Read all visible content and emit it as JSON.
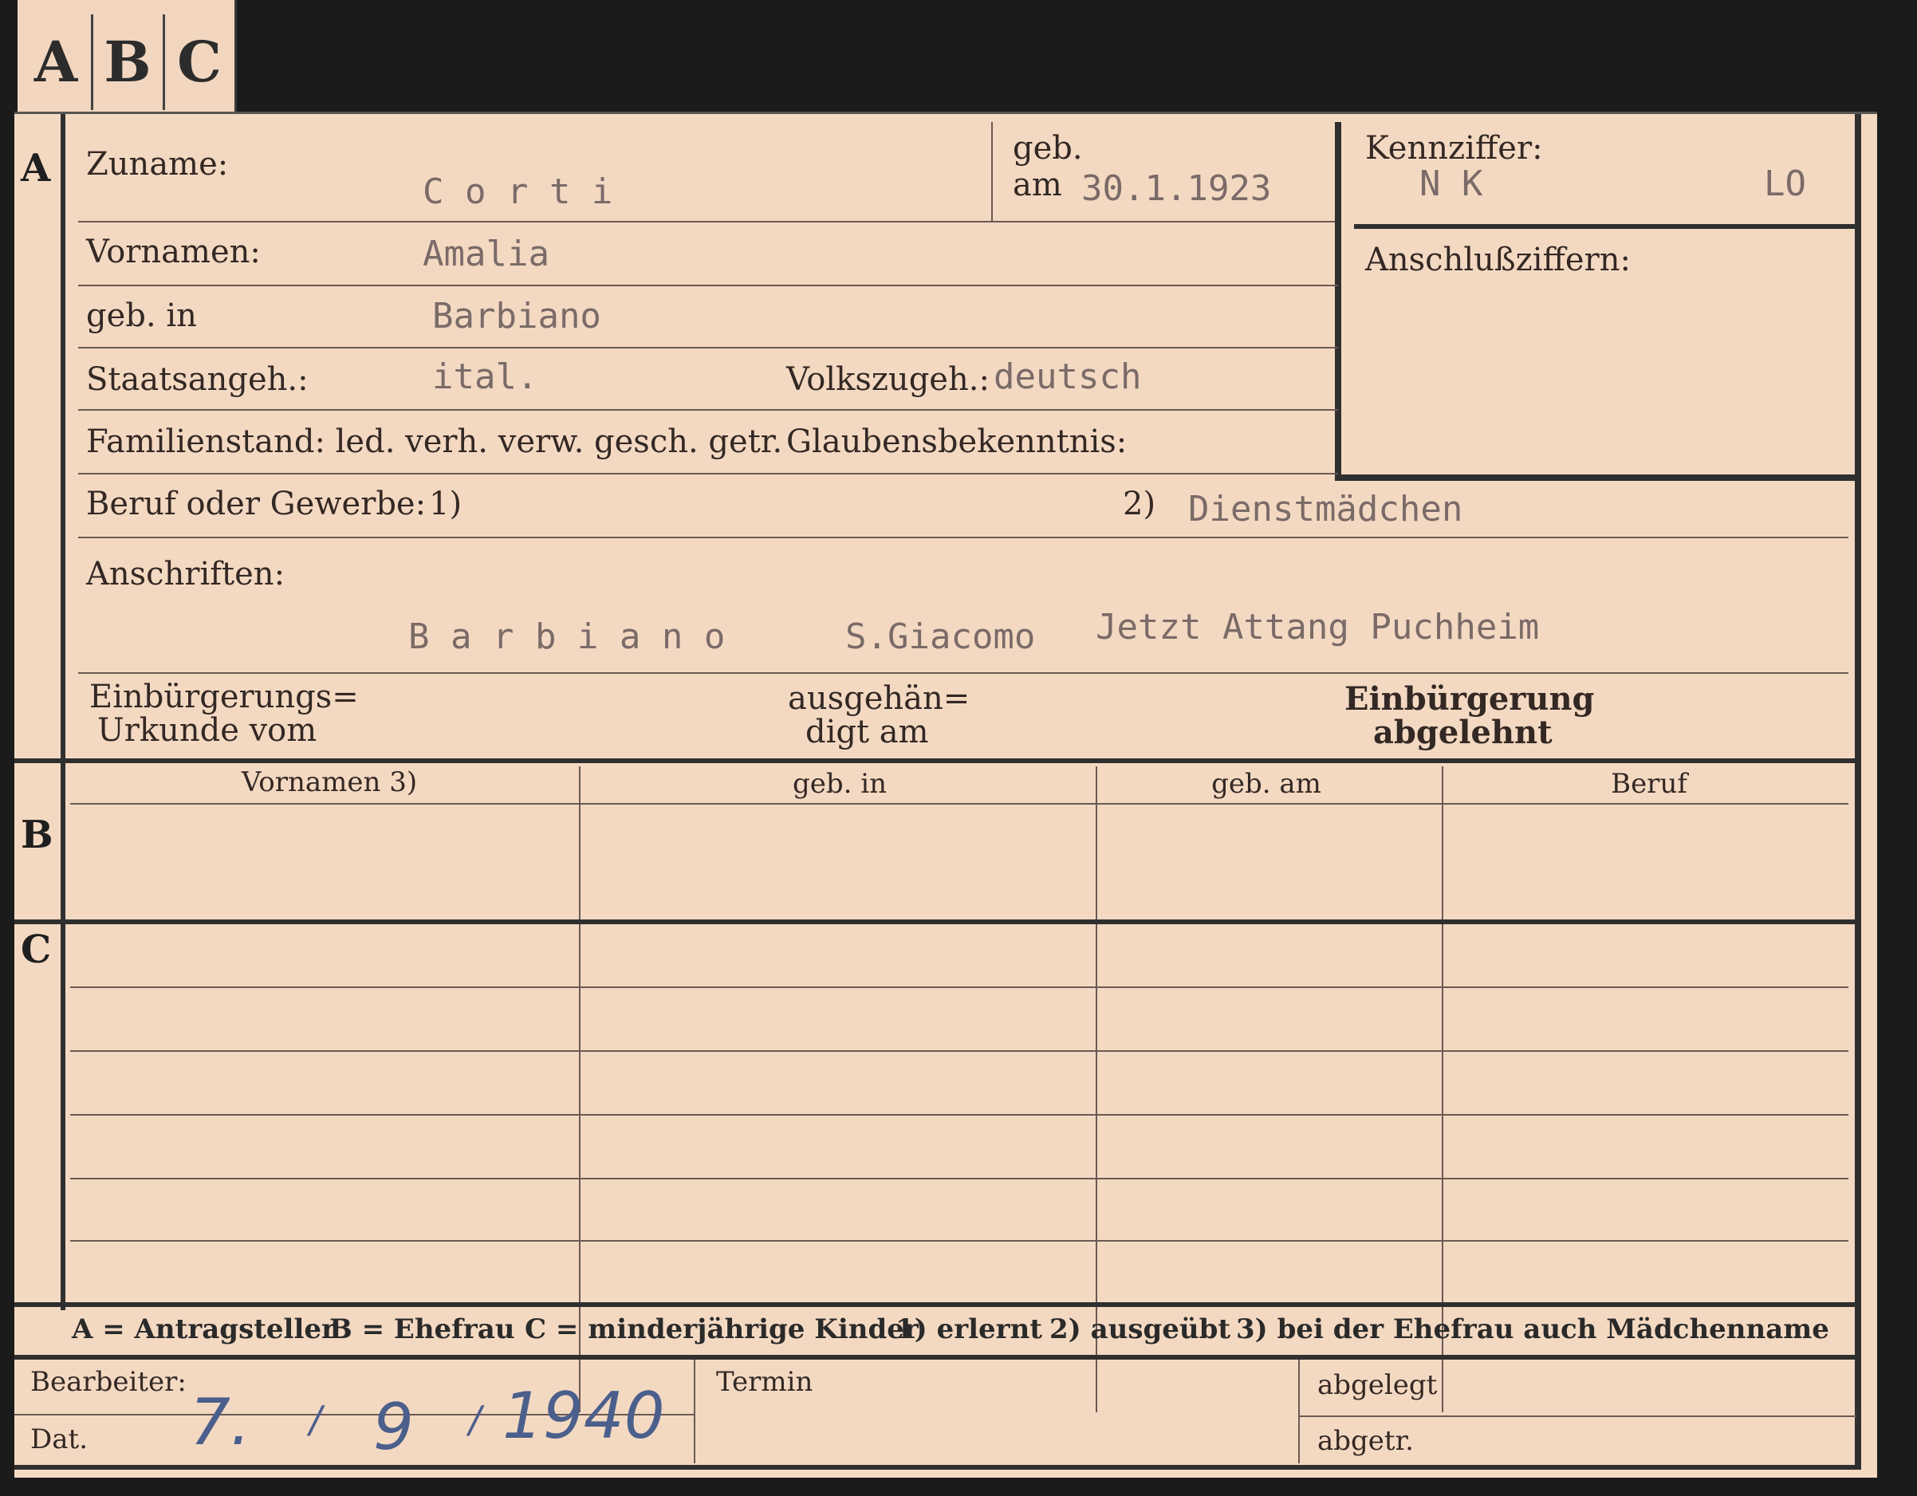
{
  "tabs": [
    "A",
    "B",
    "C"
  ],
  "sections": {
    "a": "A",
    "b": "B",
    "c": "C"
  },
  "labels": {
    "zuname": "Zuname:",
    "geb_line1": "geb.",
    "geb_line2": "am",
    "kennziffer": "Kennziffer:",
    "vornamen": "Vornamen:",
    "anschlussziffern": "Anschlußziffern:",
    "geb_in": "geb. in",
    "staatsangeh": "Staatsangeh.:",
    "volkszugeh": "Volkszugeh.:",
    "familienstand": "Familienstand: led. verh. verw. gesch. getr.",
    "glaubensbekenntnis": "Glaubensbekenntnis:",
    "beruf": "Beruf oder Gewerbe:",
    "note1": "1)",
    "note2": "2)",
    "anschriften": "Anschriften:",
    "einbuergerung_urkunde_1": "Einbürgerungs=",
    "einbuergerung_urkunde_2": "Urkunde vom",
    "ausgehaendigt_1": "ausgehän=",
    "ausgehaendigt_2": "digt am",
    "einbuergerung_abgelehnt_1": "Einbürgerung",
    "einbuergerung_abgelehnt_2": "abgelehnt"
  },
  "values": {
    "zuname": "C o r t i",
    "geb_am": "30.1.1923",
    "kennziffer_left": "N K",
    "kennziffer_right": "LO",
    "vornamen": "Amalia",
    "geb_in": "Barbiano",
    "staatsangeh": "ital.",
    "volkszugeh": "deutsch",
    "beruf_ausgeuebt": "Dienstmädchen",
    "anschrift_1": "B a r b i a n o",
    "anschrift_2": "S.Giacomo",
    "anschrift_3": "Jetzt Attang Puchheim"
  },
  "table": {
    "headers": [
      "Vornamen 3)",
      "geb. in",
      "geb. am",
      "Beruf"
    ]
  },
  "legend": {
    "a": "A = Antragsteller",
    "b": "B = Ehefrau",
    "c": "C = minderjährige Kinder",
    "n1": "1) erlernt",
    "n2": "2) ausgeübt",
    "n3": "3) bei der Ehefrau auch Mädchenname"
  },
  "footer": {
    "bearbeiter": "Bearbeiter:",
    "dat": "Dat.",
    "dat_day": "7.",
    "dat_sep1": "/",
    "dat_month": "9",
    "dat_sep2": "/",
    "dat_year": "1940",
    "termin": "Termin",
    "abgelegt": "abgelegt",
    "abgetr": "abgetr."
  }
}
